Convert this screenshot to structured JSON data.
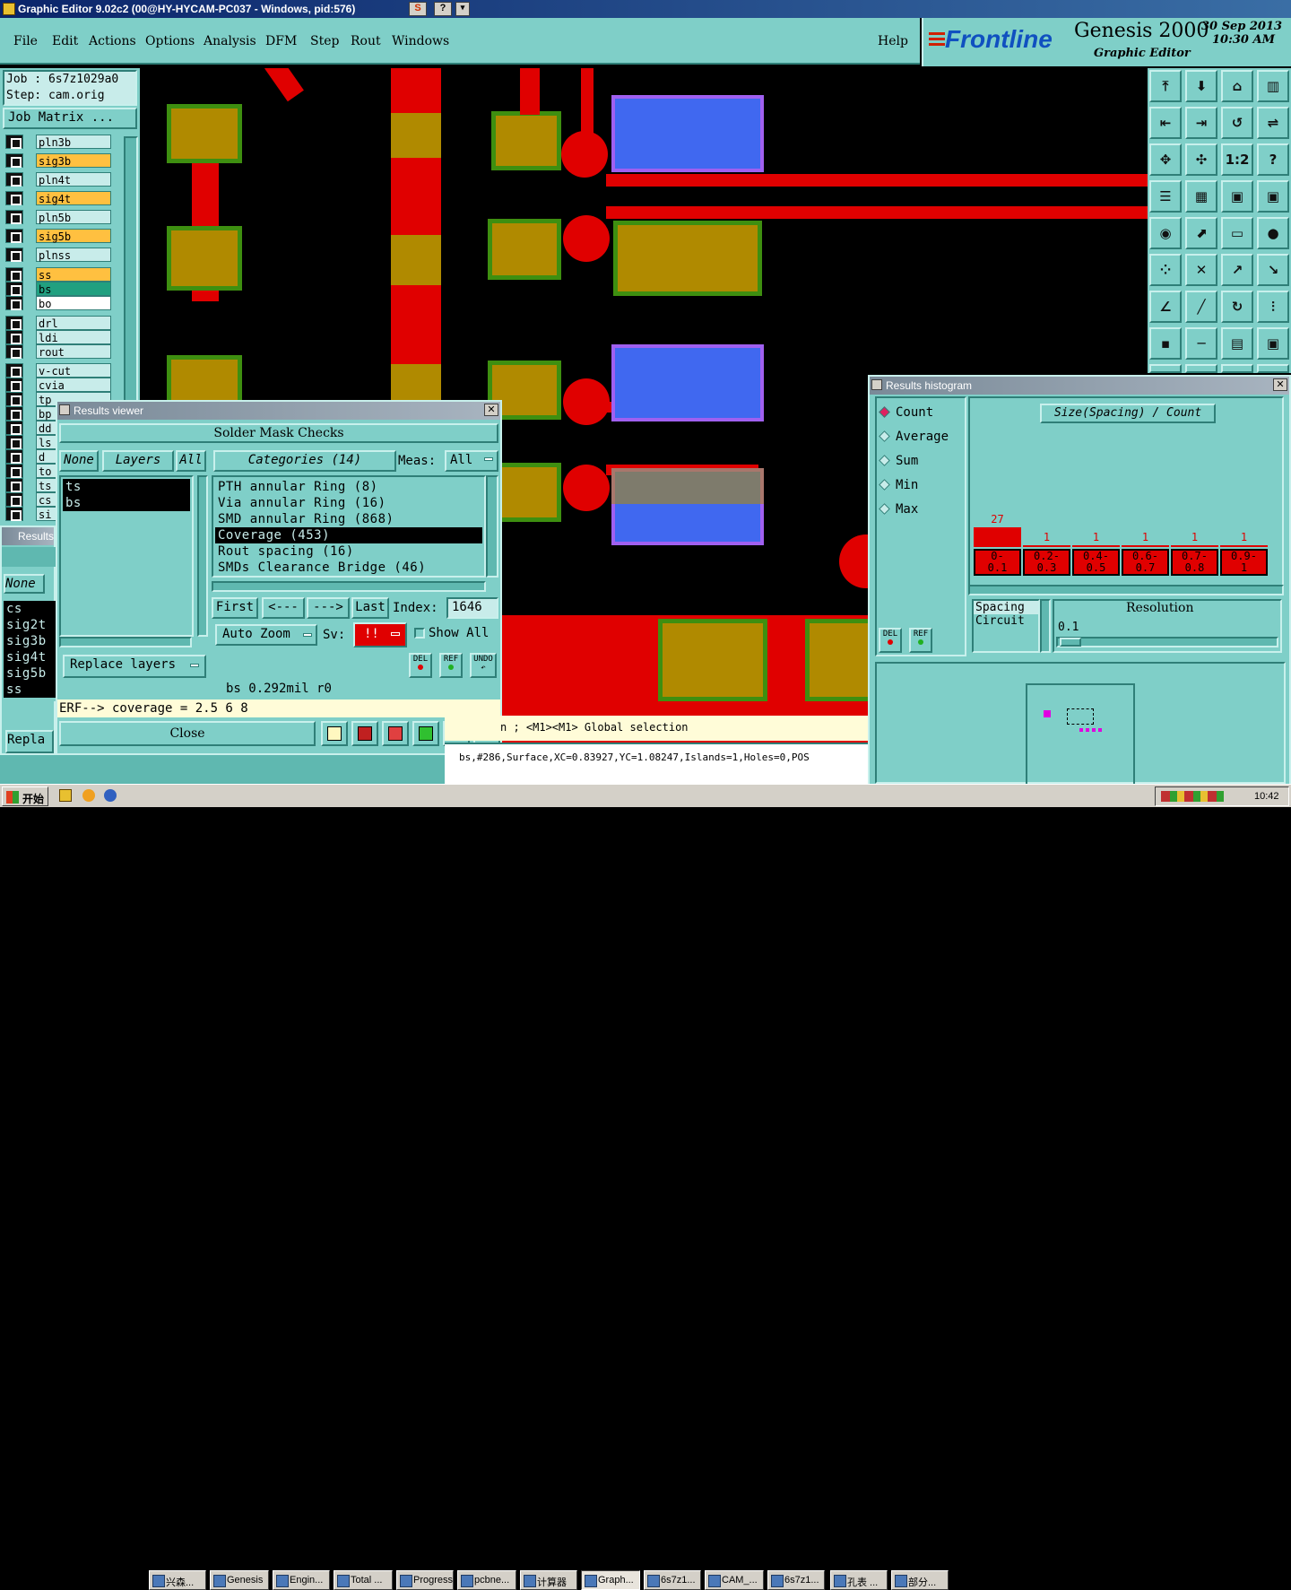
{
  "window": {
    "title": "Graphic Editor 9.02c2 (00@HY-HYCAM-PC037 - Windows, pid:576)"
  },
  "menu": {
    "items": [
      "File",
      "Edit",
      "Actions",
      "Options",
      "Analysis",
      "DFM",
      "Step",
      "Rout",
      "Windows"
    ],
    "help": "Help"
  },
  "brand": {
    "logo": "Frontline",
    "product": "Genesis 2000",
    "subtitle": "Graphic Editor",
    "date": "30 Sep 2013",
    "time": "10:30 AM"
  },
  "job": {
    "job_label": "Job : 6s7z1029a0",
    "step_label": "Step: cam.orig",
    "matrix_button": "Job Matrix ..."
  },
  "layers": [
    {
      "name": "pln3b",
      "color": "#c8ecea"
    },
    {
      "name": "sig3b",
      "color": "#ffc040"
    },
    {
      "name": "pln4t",
      "color": "#c8ecea"
    },
    {
      "name": "sig4t",
      "color": "#ffc040"
    },
    {
      "name": "pln5b",
      "color": "#c8ecea"
    },
    {
      "name": "sig5b",
      "color": "#ffc040"
    },
    {
      "name": "plnss",
      "color": "#c8ecea"
    },
    {
      "name": "ss",
      "color": "#ffc040"
    },
    {
      "name": "bs",
      "color": "#20a080"
    },
    {
      "name": "bo",
      "color": "#ffffff"
    },
    {
      "name": "drl",
      "color": "#c8ecea"
    },
    {
      "name": "ldi",
      "color": "#c8ecea"
    },
    {
      "name": "rout",
      "color": "#c8ecea"
    },
    {
      "name": "v-cut",
      "color": "#c8ecea"
    },
    {
      "name": "cvia",
      "color": "#c8ecea"
    },
    {
      "name": "tp",
      "color": "#c8ecea"
    },
    {
      "name": "bp",
      "color": "#c8ecea"
    },
    {
      "name": "dd",
      "color": "#c8ecea"
    },
    {
      "name": "ls",
      "color": "#c8ecea"
    },
    {
      "name": "d",
      "color": "#c8ecea"
    },
    {
      "name": "to",
      "color": "#c8ecea"
    },
    {
      "name": "ts",
      "color": "#c8ecea"
    },
    {
      "name": "cs",
      "color": "#c8ecea"
    },
    {
      "name": "si",
      "color": "#c8ecea"
    }
  ],
  "back_results": {
    "title": "Results",
    "none": "None",
    "layers": [
      "cs",
      "sig2t",
      "sig3b",
      "sig4t",
      "sig5b",
      "ss"
    ],
    "replace": "Repla"
  },
  "results_viewer": {
    "title": "Results viewer",
    "heading": "Solder Mask Checks",
    "none_label": "None",
    "layers_label": "Layers",
    "all_label": "All",
    "layer_items": [
      "ts",
      "bs"
    ],
    "categories_label": "Categories (14)",
    "meas_label": "Meas:",
    "meas_value": "All",
    "categories": [
      "PTH annular Ring (8)",
      "Via annular Ring (16)",
      "SMD annular Ring (868)",
      "Coverage (453)",
      "Rout spacing (16)",
      "SMDs Clearance Bridge (46)"
    ],
    "selected_category": "Coverage (453)",
    "first": "First",
    "prev": "<---",
    "next": "--->",
    "last": "Last",
    "index_label": "Index:",
    "index_value": "1646",
    "auto_zoom": "Auto Zoom",
    "sv_label": "Sv:",
    "sv_value": "!!",
    "show_all": "Show All",
    "del": "DEL",
    "ref": "REF",
    "undo": "UNDO",
    "replace_layers": "Replace layers",
    "status": "bs 0.292mil r0",
    "erf": "ERF--> coverage = 2.5 6 8",
    "close": "Close"
  },
  "histogram": {
    "title": "Results histogram",
    "options": [
      "Count",
      "Average",
      "Sum",
      "Min",
      "Max"
    ],
    "selected_option": "Count",
    "header": "Size(Spacing) / Count",
    "bars": [
      {
        "range": "0-0.1",
        "count": 27
      },
      {
        "range": "0.2-0.3",
        "count": 1
      },
      {
        "range": "0.4-0.5",
        "count": 1
      },
      {
        "range": "0.6-0.7",
        "count": 1
      },
      {
        "range": "0.7-0.8",
        "count": 1
      },
      {
        "range": "0.9-1",
        "count": 1
      }
    ],
    "bar_labels": [
      [
        "0-",
        "0.1"
      ],
      [
        "0.2-",
        "0.3"
      ],
      [
        "0.4-",
        "0.5"
      ],
      [
        "0.6-",
        "0.7"
      ],
      [
        "0.7-",
        "0.8"
      ],
      [
        "0.9-",
        "1"
      ]
    ],
    "list_items": [
      "Spacing",
      "Circuit"
    ],
    "resolution_label": "Resolution",
    "resolution_value": "0.1",
    "del": "DEL",
    "ref": "REF"
  },
  "status_bar": {
    "selection_msg": "n ; <M1><M1> Global selection",
    "feature_info": "bs,#286,Surface,XC=0.83927,YC=1.08247,Islands=1,Holes=0,POS"
  },
  "taskbar": {
    "start": "开始",
    "items": [
      "兴森...",
      "Genesis",
      "Engin...",
      "Total ...",
      "Progress",
      "pcbne...",
      "计算器",
      "Graph...",
      "6s7z1...",
      "CAM_...",
      "6s7z1...",
      "孔表 ...",
      "部分..."
    ],
    "clock": "10:42"
  }
}
